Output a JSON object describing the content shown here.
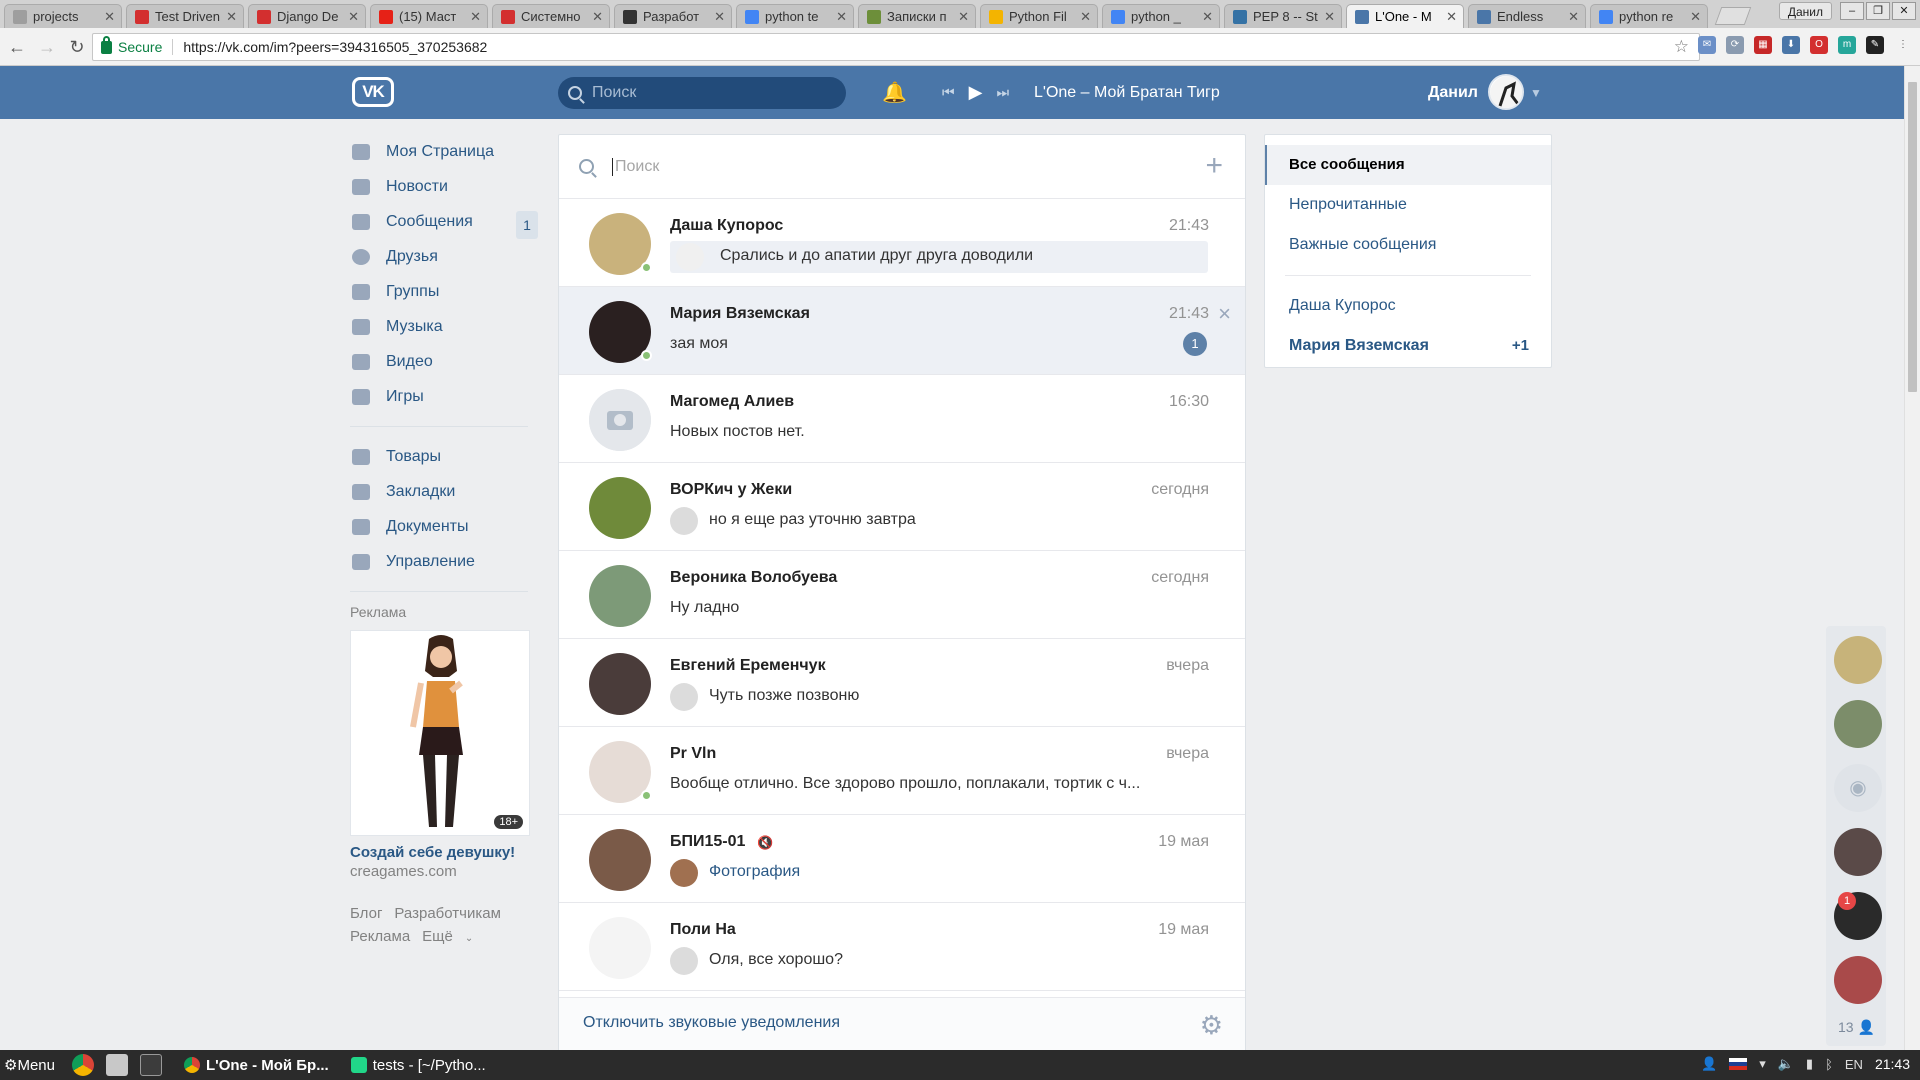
{
  "browser": {
    "tabs": [
      {
        "title": "projects",
        "favicon": "page-icon",
        "color": "#9e9e9e"
      },
      {
        "title": "Test Driven",
        "favicon": "rp-icon",
        "color": "#d32f2f"
      },
      {
        "title": "Django De",
        "favicon": "rp-icon",
        "color": "#d32f2f"
      },
      {
        "title": "(15) Маст",
        "favicon": "youtube-icon",
        "color": "#e62117"
      },
      {
        "title": "Системно",
        "favicon": "target-icon",
        "color": "#d32f2f"
      },
      {
        "title": "Разработ",
        "favicon": "gamepad-icon",
        "color": "#333333"
      },
      {
        "title": "python te",
        "favicon": "google-icon",
        "color": "#4285f4"
      },
      {
        "title": "Записки п",
        "favicon": "image-icon",
        "color": "#6d8f3a"
      },
      {
        "title": "Python Fil",
        "favicon": "book-icon",
        "color": "#f4b400"
      },
      {
        "title": "python _",
        "favicon": "google-icon",
        "color": "#4285f4"
      },
      {
        "title": "PEP 8 -- St",
        "favicon": "python-icon",
        "color": "#3572a5"
      },
      {
        "title": "L'One - M",
        "favicon": "vk-icon",
        "color": "#4a76a8",
        "active": true
      },
      {
        "title": "Endless",
        "favicon": "play-icon",
        "color": "#4a76a8"
      },
      {
        "title": "python re",
        "favicon": "google-icon",
        "color": "#4285f4"
      }
    ],
    "profile_label": "Данил",
    "secure_label": "Secure",
    "url": "https://vk.com/im?peers=394316505_370253682"
  },
  "vk": {
    "header": {
      "search_placeholder": "Поиск",
      "now_playing": "L'One – Мой Братан Тигр",
      "user_name": "Данил"
    },
    "menu": {
      "items": [
        {
          "label": "Моя Страница",
          "icon": "home-icon"
        },
        {
          "label": "Новости",
          "icon": "news-icon"
        },
        {
          "label": "Сообщения",
          "icon": "messages-icon",
          "badge": "1"
        },
        {
          "label": "Друзья",
          "icon": "friends-icon"
        },
        {
          "label": "Группы",
          "icon": "groups-icon"
        },
        {
          "label": "Музыка",
          "icon": "music-icon"
        },
        {
          "label": "Видео",
          "icon": "video-icon"
        },
        {
          "label": "Игры",
          "icon": "games-icon"
        }
      ],
      "items2": [
        {
          "label": "Товары",
          "icon": "bag-icon"
        },
        {
          "label": "Закладки",
          "icon": "star-icon"
        },
        {
          "label": "Документы",
          "icon": "document-icon"
        },
        {
          "label": "Управление",
          "icon": "gamepad-icon"
        }
      ],
      "ads_title": "Реклама",
      "ad": {
        "age": "18+",
        "title": "Создай себе девушку!",
        "domain": "creagames.com"
      },
      "footer": {
        "blog": "Блог",
        "devs": "Разработчикам",
        "ads": "Реклама",
        "more": "Ещё"
      }
    },
    "dialogs": {
      "search_placeholder": "Поиск",
      "rows": [
        {
          "name": "Даша Купорос",
          "time": "21:43",
          "text": "Срались и до апатии друг друга доводили",
          "reply": true,
          "online": true
        },
        {
          "name": "Мария Вяземская",
          "time": "21:43",
          "text": "зая моя",
          "unread": "1",
          "online": true
        },
        {
          "name": "Магомед Алиев",
          "time": "16:30",
          "text": "Новых постов нет."
        },
        {
          "name": "ВОРКич у Жеки",
          "time": "сегодня",
          "text": "но я еще раз уточню завтра",
          "mini": true
        },
        {
          "name": "Вероника Волобуева",
          "time": "сегодня",
          "text": "Ну ладно"
        },
        {
          "name": "Евгений Еременчук",
          "time": "вчера",
          "text": "Чуть позже позвоню",
          "mini": true
        },
        {
          "name": "Pr Vln",
          "time": "вчера",
          "text": "Вообще отлично. Все здорово прошло, поплакали, тортик с ч...",
          "online": true
        },
        {
          "name": "БПИ15-01",
          "time": "19 мая",
          "text": "Фотография",
          "mini": true,
          "muted": true
        },
        {
          "name": "Поли На",
          "time": "19 мая",
          "text": "Оля, все хорошо?",
          "mini": true
        }
      ],
      "footer_link": "Отключить звуковые уведомления"
    },
    "folders": {
      "all": "Все сообщения",
      "unread": "Непрочитанные",
      "important": "Важные сообщения",
      "peer1": "Даша Купорос",
      "peer2": "Мария Вяземская",
      "peer2_count": "+1"
    },
    "chatbar": {
      "badge": "1",
      "count": "13"
    }
  },
  "taskbar": {
    "menu": "Menu",
    "task1": "L'One - Мой Бр...",
    "task2": "tests - [~/Pytho...",
    "lang": "EN",
    "clock": "21:43"
  }
}
